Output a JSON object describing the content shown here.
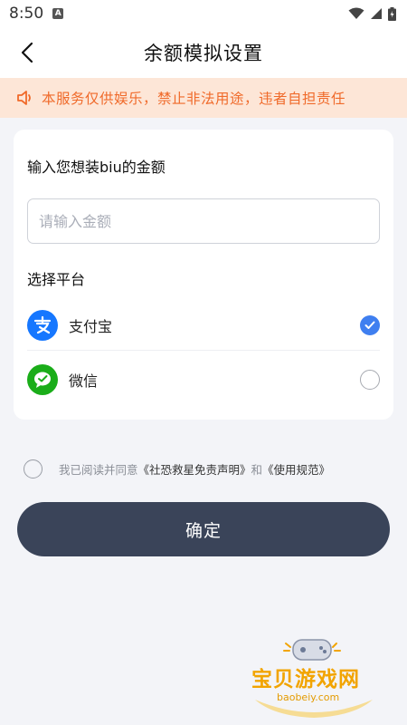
{
  "status": {
    "time": "8:50",
    "badge": "A"
  },
  "nav": {
    "title": "余额模拟设置"
  },
  "notice": {
    "text": "本服务仅供娱乐，禁止非法用途，违者自担责任"
  },
  "amount": {
    "title": "输入您想装biu的金额",
    "placeholder": "请输入金额",
    "value": ""
  },
  "platform": {
    "title": "选择平台",
    "options": [
      {
        "label": "支付宝",
        "icon": "alipay-icon",
        "selected": true,
        "color": "#1677ff"
      },
      {
        "label": "微信",
        "icon": "wechat-icon",
        "selected": false,
        "color": "#1aad19"
      }
    ]
  },
  "agreement": {
    "prefix": "我已阅读并同意",
    "link1": "《社恐救星免责声明》",
    "joiner": "和",
    "link2": "《使用规范》",
    "checked": false
  },
  "confirm": {
    "label": "确定"
  },
  "watermark": {
    "title": "宝贝游戏网",
    "site": "baobeiy.com"
  },
  "colors": {
    "accent": "#3f7ff0",
    "notice_bg": "#fde6d7",
    "notice_text": "#f06a2a",
    "button": "#3a4459"
  }
}
